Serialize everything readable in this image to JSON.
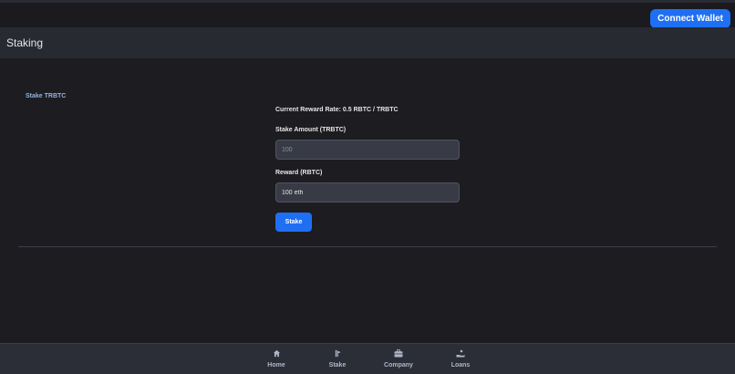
{
  "header": {
    "connect_wallet_label": "Connect Wallet"
  },
  "page": {
    "title": "Staking"
  },
  "stake_section": {
    "label": "Stake TRBTC",
    "reward_rate_text": "Current Reward Rate: 0.5 RBTC / TRBTC",
    "stake_amount_label": "Stake Amount (TRBTC)",
    "stake_amount_placeholder": "100",
    "reward_label": "Reward (RBTC)",
    "reward_value": "100 eth",
    "stake_button_label": "Stake"
  },
  "bottom_nav": {
    "items": [
      {
        "label": "Home",
        "icon": "home-icon"
      },
      {
        "label": "Stake",
        "icon": "stake-icon"
      },
      {
        "label": "Company",
        "icon": "briefcase-icon"
      },
      {
        "label": "Loans",
        "icon": "loan-hand-icon"
      }
    ]
  },
  "colors": {
    "accent": "#1f6ff2",
    "background": "#1c1c21",
    "header_bg": "#272a31",
    "nav_bg": "#2b2e36",
    "section_label": "#93b4e0"
  }
}
